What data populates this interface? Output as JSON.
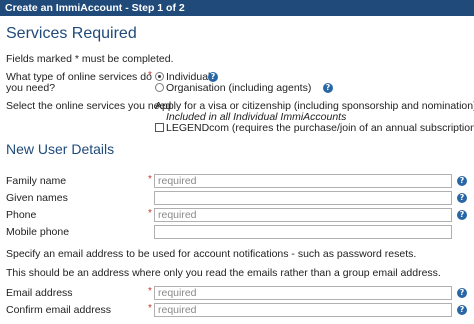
{
  "window": {
    "title": "Create an ImmiAccount - Step 1 of 2"
  },
  "services_section": {
    "heading": "Services Required",
    "required_note": "Fields marked * must be completed.",
    "service_type": {
      "label_line1": "What type of online services do",
      "label_line2": "you need?",
      "options": [
        {
          "label": "Individual",
          "selected": true
        },
        {
          "label": "Organisation (including agents)",
          "selected": false
        }
      ]
    },
    "select_services": {
      "label": "Select the online services you need",
      "visa_service": "Apply for a visa or citizenship (including sponsorship and nomination)",
      "included_note": "Included in all Individual ImmiAccounts",
      "legend_option": {
        "label": "LEGENDcom (requires the purchase/join of an annual subscription)",
        "checked": false
      }
    }
  },
  "user_section": {
    "heading": "New User Details",
    "fields": {
      "family_name": {
        "label": "Family name",
        "placeholder": "required",
        "value": ""
      },
      "given_names": {
        "label": "Given names",
        "placeholder": "",
        "value": ""
      },
      "phone": {
        "label": "Phone",
        "placeholder": "required",
        "value": ""
      },
      "mobile_phone": {
        "label": "Mobile phone",
        "placeholder": "",
        "value": ""
      },
      "email_address": {
        "label": "Email address",
        "placeholder": "required",
        "value": ""
      },
      "confirm_email": {
        "label": "Confirm email address",
        "placeholder": "required",
        "value": ""
      }
    },
    "email_note_1": "Specify an email address to be used for account notifications - such as password resets.",
    "email_note_2": "This should be an address where only you read the emails rather than a group email address."
  },
  "glyphs": {
    "required_star": "*",
    "help": "?"
  },
  "colors": {
    "titlebar": "#1f4a7a",
    "heading": "#1f4a7a",
    "required_star": "#c0392b",
    "help_icon": "#2866a5"
  }
}
